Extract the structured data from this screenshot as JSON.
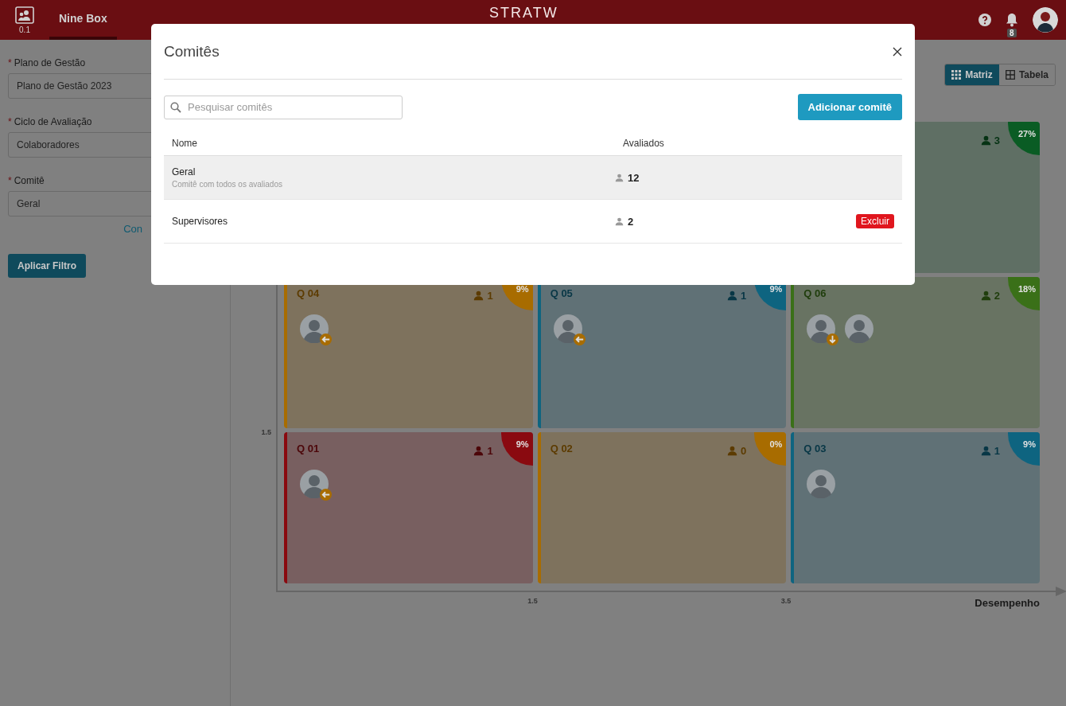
{
  "header": {
    "app_version": "0.1",
    "tabs": [
      {
        "label": "Nine Box",
        "selected": true
      }
    ],
    "logo": "STRATW",
    "notification_count": "8"
  },
  "sidebar": {
    "fields": [
      {
        "mark": "*",
        "label": "Plano de Gestão",
        "value": "Plano de Gestão 2023"
      },
      {
        "mark": "*",
        "label": "Ciclo de Avaliação",
        "value": "Colaboradores"
      },
      {
        "mark": "*",
        "label": "Comitê",
        "value": "Geral"
      }
    ],
    "link": "Con",
    "apply_button": "Aplicar Filtro"
  },
  "view_toggle": [
    {
      "label": "Matriz",
      "selected": true
    },
    {
      "label": "Tabela",
      "selected": false
    }
  ],
  "matrix": {
    "rows": [
      [
        "",
        "",
        {
          "count": "3",
          "percent": "27%",
          "color": "#0a5c24"
        }
      ],
      [
        {
          "label": "Q 04",
          "count": "1",
          "percent": "9%",
          "color": "#a86c00",
          "avatars": [
            {
              "kind": "moved-left"
            }
          ]
        },
        {
          "label": "Q 05",
          "count": "1",
          "percent": "9%",
          "color": "#0e6480",
          "avatars": [
            {
              "kind": "moved-left"
            }
          ]
        },
        {
          "label": "Q 06",
          "count": "2",
          "percent": "18%",
          "color": "#3a7018",
          "avatars": [
            {
              "kind": "moved-down"
            },
            {
              "kind": "plain"
            }
          ]
        }
      ],
      [
        {
          "label": "Q 01",
          "count": "1",
          "percent": "9%",
          "color": "#8a0a10",
          "avatars": [
            {
              "kind": "moved-left"
            }
          ]
        },
        {
          "label": "Q 02",
          "count": "0",
          "percent": "0%",
          "color": "#a86c00"
        },
        {
          "label": "Q 03",
          "count": "1",
          "percent": "9%",
          "color": "#0e6480",
          "avatars": [
            {
              "kind": "plain"
            }
          ]
        }
      ]
    ],
    "y_ticks": [
      "1.5"
    ],
    "x_ticks": [
      "1.5",
      "3.5"
    ],
    "x_label": "Desempenho"
  },
  "modal": {
    "title": "Comitês",
    "search": {
      "placeholder": "Pesquisar comitês"
    },
    "add_button": "Adicionar comitê",
    "columns": [
      "Nome",
      "Avaliados"
    ],
    "rows": [
      {
        "name": "Geral",
        "description": "Comitê com todos os avaliados",
        "count": "12",
        "highlighted": true
      },
      {
        "name": "Supervisores",
        "count": "2",
        "delete_button": "Excluir",
        "highlighted": false
      }
    ]
  }
}
